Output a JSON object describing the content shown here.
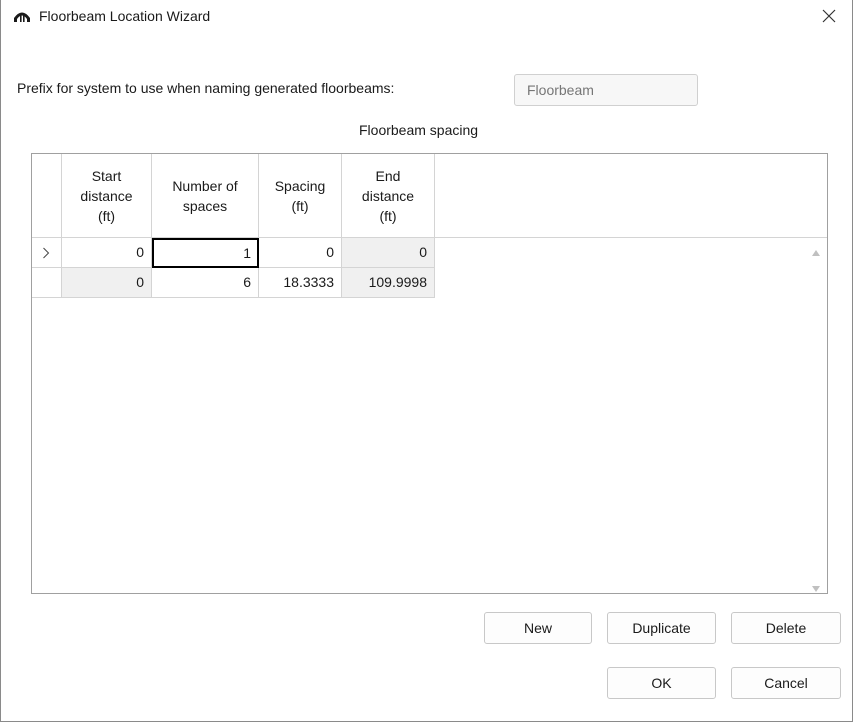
{
  "window": {
    "title": "Floorbeam Location Wizard",
    "icon": "bridge-arch-icon"
  },
  "prefix": {
    "label": "Prefix for system to use when naming generated floorbeams:",
    "value": "Floorbeam"
  },
  "table": {
    "caption": "Floorbeam spacing",
    "columns": [
      [
        "Start",
        "distance",
        "(ft)"
      ],
      [
        "Number of",
        "spaces"
      ],
      [
        "Spacing",
        "(ft)"
      ],
      [
        "End",
        "distance",
        "(ft)"
      ]
    ],
    "rows": [
      {
        "indicator": "chevron-right-icon",
        "cells": [
          "0",
          "1",
          "0",
          "0"
        ]
      },
      {
        "indicator": "",
        "cells": [
          "0",
          "6",
          "18.3333",
          "109.9998"
        ]
      }
    ]
  },
  "buttons": {
    "new": "New",
    "duplicate": "Duplicate",
    "delete": "Delete",
    "ok": "OK",
    "cancel": "Cancel"
  }
}
